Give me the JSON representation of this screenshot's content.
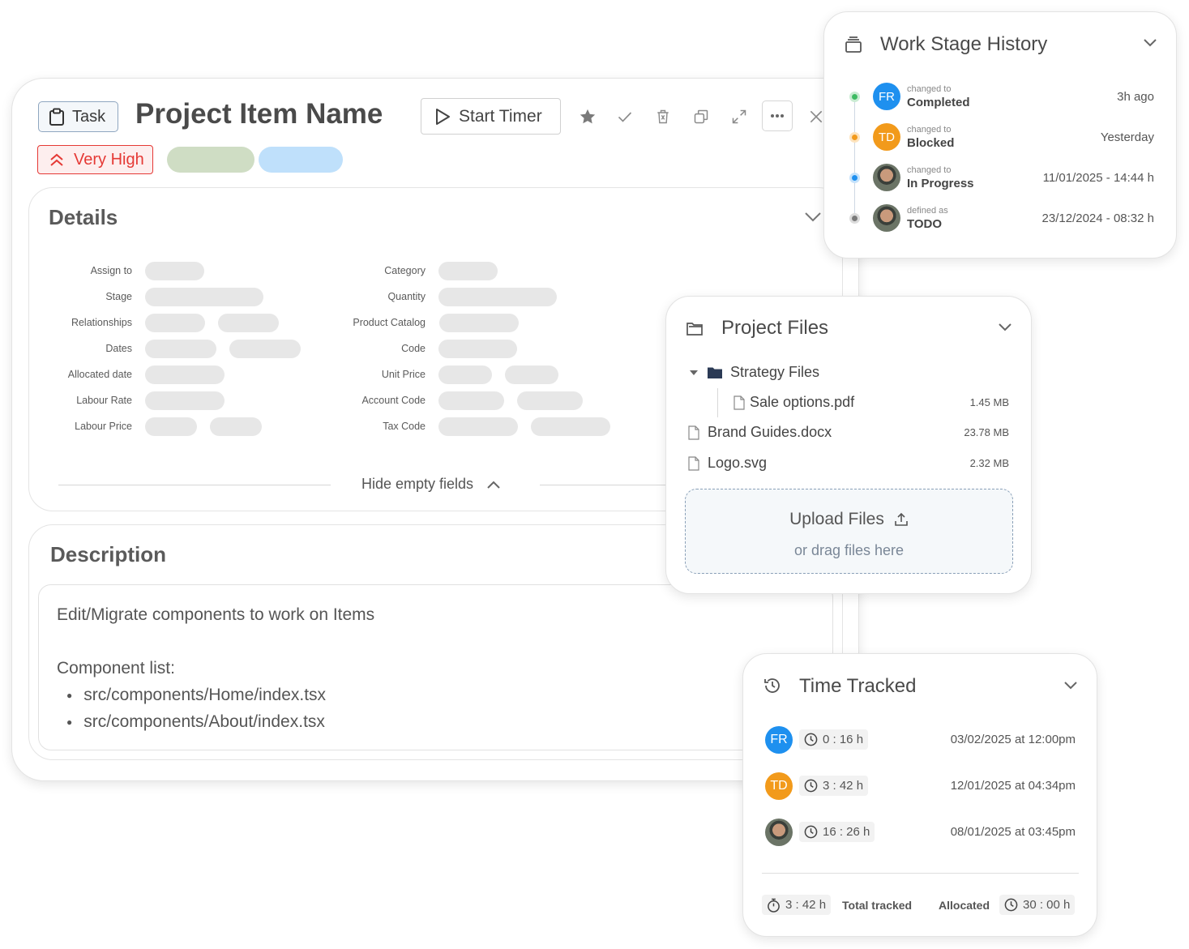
{
  "item": {
    "type_label": "Task",
    "title": "Project Item Name",
    "start_timer_label": "Start Timer",
    "priority_label": "Very High"
  },
  "details": {
    "title": "Details",
    "left_labels": [
      "Assign to",
      "Stage",
      "Relationships",
      "Dates",
      "Allocated date",
      "Labour Rate",
      "Labour Price"
    ],
    "right_labels": [
      "Category",
      "Quantity",
      "Product Catalog",
      "Code",
      "Unit Price",
      "Account Code",
      "Tax Code"
    ],
    "toggle_label": "Hide empty fields"
  },
  "description": {
    "title": "Description",
    "line1": "Edit/Migrate components to work on Items",
    "line2": "Component list:",
    "bullets": [
      "src/components/Home/index.tsx",
      "src/components/About/index.tsx"
    ]
  },
  "history": {
    "title": "Work Stage History",
    "entries": [
      {
        "initials": "FR",
        "caption": "changed to",
        "stage": "Completed",
        "time": "3h ago",
        "dot": "#3dbb62",
        "avatar_color": "#1e90ef"
      },
      {
        "initials": "TD",
        "caption": "changed to",
        "stage": "Blocked",
        "time": "Yesterday",
        "dot": "#f29a1b",
        "avatar_color": "#f29a1b"
      },
      {
        "initials": "",
        "caption": "changed to",
        "stage": "In Progress",
        "time": "11/01/2025 - 14:44 h",
        "dot": "#1e90ef",
        "avatar_color": ""
      },
      {
        "initials": "",
        "caption": "defined as",
        "stage": "TODO",
        "time": "23/12/2024 - 08:32 h",
        "dot": "#7a7a7a",
        "avatar_color": ""
      }
    ]
  },
  "files": {
    "title": "Project Files",
    "folder_name": "Strategy Files",
    "items": [
      {
        "name": "Sale options.pdf",
        "size": "1.45 MB"
      },
      {
        "name": "Brand Guides.docx",
        "size": "23.78 MB"
      },
      {
        "name": "Logo.svg",
        "size": "2.32 MB"
      }
    ],
    "upload_label": "Upload Files",
    "upload_hint": "or drag files here"
  },
  "time": {
    "title": "Time Tracked",
    "entries": [
      {
        "initials": "FR",
        "duration": "0 : 16 h",
        "date": "03/02/2025 at 12:00pm",
        "avatar_color": "#1e90ef"
      },
      {
        "initials": "TD",
        "duration": "3 : 42 h",
        "date": "12/01/2025 at 04:34pm",
        "avatar_color": "#f29a1b"
      },
      {
        "initials": "",
        "duration": "16 : 26 h",
        "date": "08/01/2025 at 03:45pm",
        "avatar_color": ""
      }
    ],
    "total_value": "3 : 42 h",
    "total_label": "Total tracked",
    "allocated_label": "Allocated",
    "allocated_value": "30 : 00 h"
  },
  "colors": {
    "priority": "#e53935",
    "tag1": "#cfddc4",
    "tag2": "#bfe0fb"
  },
  "icons": [
    "clipboard-icon",
    "play-icon",
    "star-icon",
    "check-icon",
    "trash-icon",
    "copy-icon",
    "expand-icon",
    "more-icon",
    "close-icon",
    "chevron-down-icon",
    "chevron-up-icon",
    "priority-up-icon",
    "stack-icon",
    "folder-icon",
    "file-icon",
    "upload-icon",
    "history-icon",
    "clock-icon",
    "stopwatch-icon"
  ]
}
